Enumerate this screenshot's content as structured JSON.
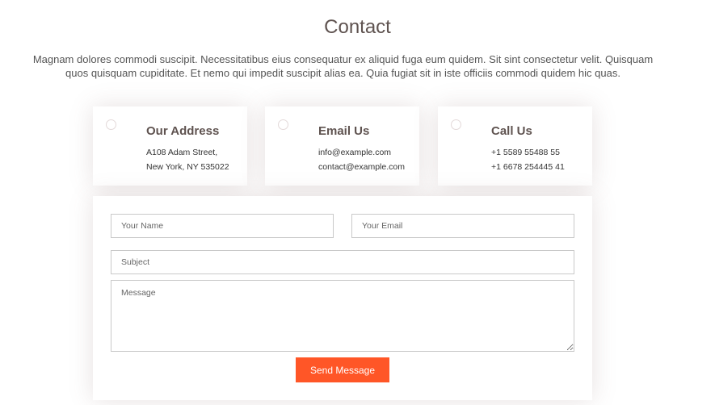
{
  "section": {
    "title": "Contact",
    "intro": "Magnam dolores commodi suscipit. Necessitatibus eius consequatur ex aliquid fuga eum quidem. Sit sint consectetur velit. Quisquam quos quisquam cupiditate. Et nemo qui impedit suscipit alias ea. Quia fugiat sit in iste officiis commodi quidem hic quas."
  },
  "cards": [
    {
      "title": "Our Address",
      "line1": "A108 Adam Street,",
      "line2": "New York, NY 535022",
      "icon": "map-pin-icon"
    },
    {
      "title": "Email Us",
      "line1": "info@example.com",
      "line2": "contact@example.com",
      "icon": "envelope-icon"
    },
    {
      "title": "Call Us",
      "line1": "+1 5589 55488 55",
      "line2": "+1 6678 254445 41",
      "icon": "phone-icon"
    }
  ],
  "form": {
    "name_placeholder": "Your Name",
    "email_placeholder": "Your Email",
    "subject_placeholder": "Subject",
    "message_placeholder": "Message",
    "submit_label": "Send Message"
  },
  "colors": {
    "accent": "#ff5627",
    "heading": "#5f5350",
    "body_text": "#555555"
  }
}
